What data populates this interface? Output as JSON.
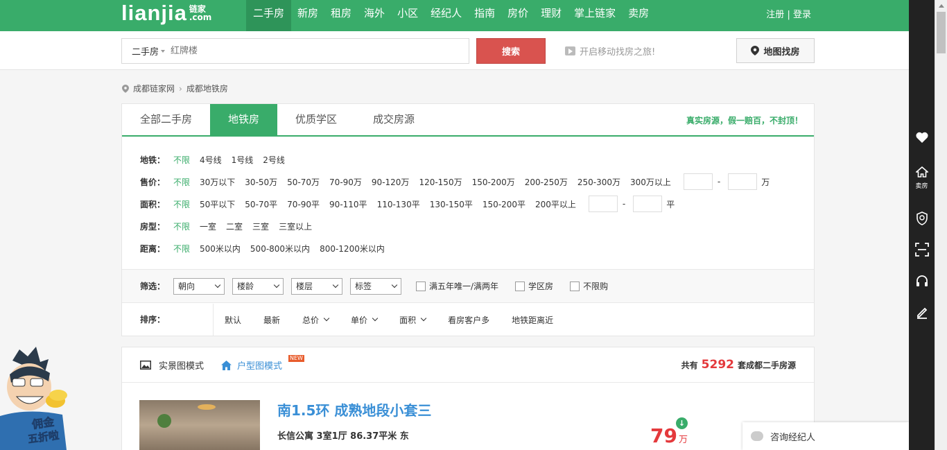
{
  "brand": {
    "wordmark": "lianjia",
    "cn": "链家",
    "dotcom": ".com"
  },
  "nav": [
    {
      "label": "二手房",
      "active": true
    },
    {
      "label": "新房"
    },
    {
      "label": "租房"
    },
    {
      "label": "海外"
    },
    {
      "label": "小区"
    },
    {
      "label": "经纪人"
    },
    {
      "label": "指南"
    },
    {
      "label": "房价"
    },
    {
      "label": "理财"
    },
    {
      "label": "掌上链家"
    },
    {
      "label": "卖房"
    }
  ],
  "auth": {
    "register": "注册",
    "sep": "|",
    "login": "登录"
  },
  "search": {
    "type": "二手房",
    "placeholder": "红牌楼",
    "button": "搜索",
    "mobile_text": "开启移动找房之旅!",
    "map_button": "地图找房"
  },
  "breadcrumb": {
    "home": "成都链家网",
    "current": "成都地铁房"
  },
  "tabs": [
    {
      "label": "全部二手房"
    },
    {
      "label": "地铁房",
      "active": true
    },
    {
      "label": "优质学区"
    },
    {
      "label": "成交房源"
    }
  ],
  "slogan": "真实房源，假一赔百，不封顶！",
  "filters": {
    "subway": {
      "label": "地铁：",
      "options": [
        "不限",
        "4号线",
        "1号线",
        "2号线"
      ]
    },
    "price": {
      "label": "售价：",
      "options": [
        "不限",
        "30万以下",
        "30-50万",
        "50-70万",
        "70-90万",
        "90-120万",
        "120-150万",
        "150-200万",
        "200-250万",
        "250-300万",
        "300万以上"
      ],
      "range_dash": "-",
      "unit": "万"
    },
    "area": {
      "label": "面积：",
      "options": [
        "不限",
        "50平以下",
        "50-70平",
        "70-90平",
        "90-110平",
        "110-130平",
        "130-150平",
        "150-200平",
        "200平以上"
      ],
      "range_dash": "-",
      "unit": "平"
    },
    "layout": {
      "label": "房型：",
      "options": [
        "不限",
        "一室",
        "二室",
        "三室",
        "三室以上"
      ]
    },
    "distance": {
      "label": "距离：",
      "options": [
        "不限",
        "500米以内",
        "500-800米以内",
        "800-1200米以内"
      ]
    }
  },
  "select_row": {
    "label": "筛选：",
    "dropdowns": [
      "朝向",
      "楼龄",
      "楼层",
      "标签"
    ],
    "checkboxes": [
      "满五年唯一/满两年",
      "学区房",
      "不限购"
    ]
  },
  "sort_row": {
    "label": "排序：",
    "items": [
      {
        "label": "默认",
        "chev": false
      },
      {
        "label": "最新",
        "chev": false
      },
      {
        "label": "总价",
        "chev": true
      },
      {
        "label": "单价",
        "chev": true
      },
      {
        "label": "面积",
        "chev": true
      },
      {
        "label": "看房客户多",
        "chev": false
      },
      {
        "label": "地铁距离近",
        "chev": false
      }
    ]
  },
  "list_header": {
    "mode_photo": "实景图模式",
    "mode_plan": "户型图模式",
    "new_badge": "NEW",
    "total_prefix": "共有",
    "total_count": "5292",
    "total_suffix": "套成都二手房源"
  },
  "listing": {
    "title": "南1.5环 成熟地段小套三",
    "info": "长信公寓  3室1厅  86.37平米  东",
    "price": "79",
    "price_unit": "万",
    "down_icon": "↓"
  },
  "consult": {
    "label": "咨询经纪人"
  },
  "mascot": {
    "text_top": "佣金",
    "text_bottom": "五折啦"
  },
  "sidebar": {
    "sell_label": "卖房"
  },
  "colors": {
    "green": "#39ac6a",
    "red": "#d9534f",
    "blue": "#3a8fd6",
    "price_red": "#e4393c"
  }
}
